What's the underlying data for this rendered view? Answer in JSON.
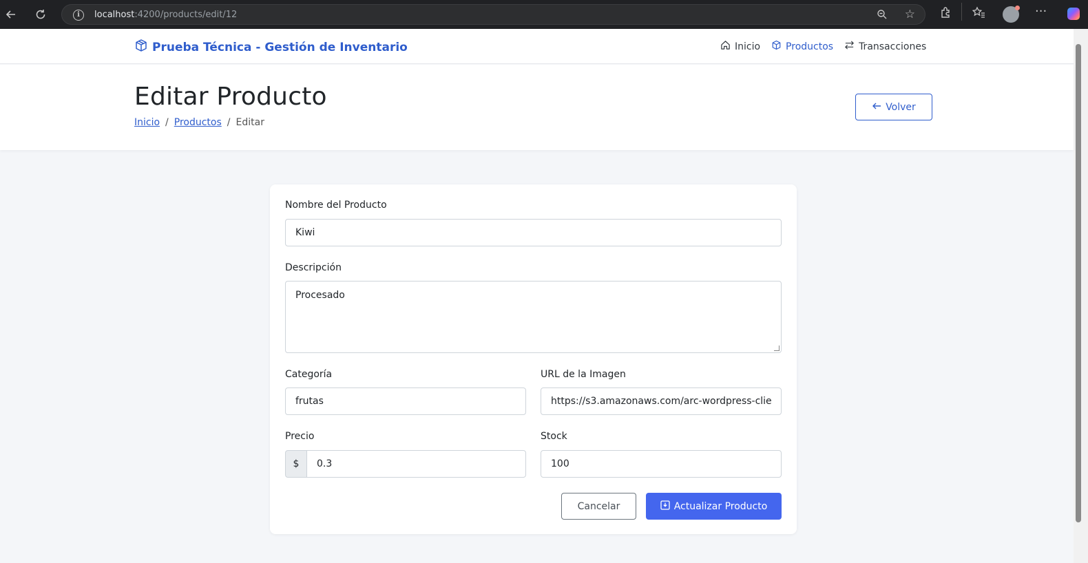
{
  "browser": {
    "url_host": "localhost",
    "url_rest": ":4200/products/edit/12"
  },
  "navbar": {
    "brand": "Prueba Técnica - Gestión de Inventario",
    "links": [
      {
        "label": "Inicio",
        "icon": "home-icon",
        "active": false
      },
      {
        "label": "Productos",
        "icon": "box-icon",
        "active": true
      },
      {
        "label": "Transacciones",
        "icon": "arrows-exchange-icon",
        "active": false
      }
    ]
  },
  "header": {
    "title": "Editar Producto",
    "breadcrumb": [
      "Inicio",
      "Productos",
      "Editar"
    ],
    "separator": "/",
    "back_button": "Volver"
  },
  "form": {
    "name": {
      "label": "Nombre del Producto",
      "value": "Kiwi"
    },
    "description": {
      "label": "Descripción",
      "value": "Procesado"
    },
    "category": {
      "label": "Categoría",
      "value": "frutas"
    },
    "image_url": {
      "label": "URL de la Imagen",
      "value": "https://s3.amazonaws.com/arc-wordpress-clie"
    },
    "price": {
      "label": "Precio",
      "prefix": "$",
      "value": "0.3"
    },
    "stock": {
      "label": "Stock",
      "value": "100"
    },
    "cancel_button": "Cancelar",
    "submit_button": "Actualizar Producto"
  },
  "colors": {
    "primary": "#2f5dcc",
    "submit": "#4466ee",
    "page_bg": "#f4f6f9"
  }
}
